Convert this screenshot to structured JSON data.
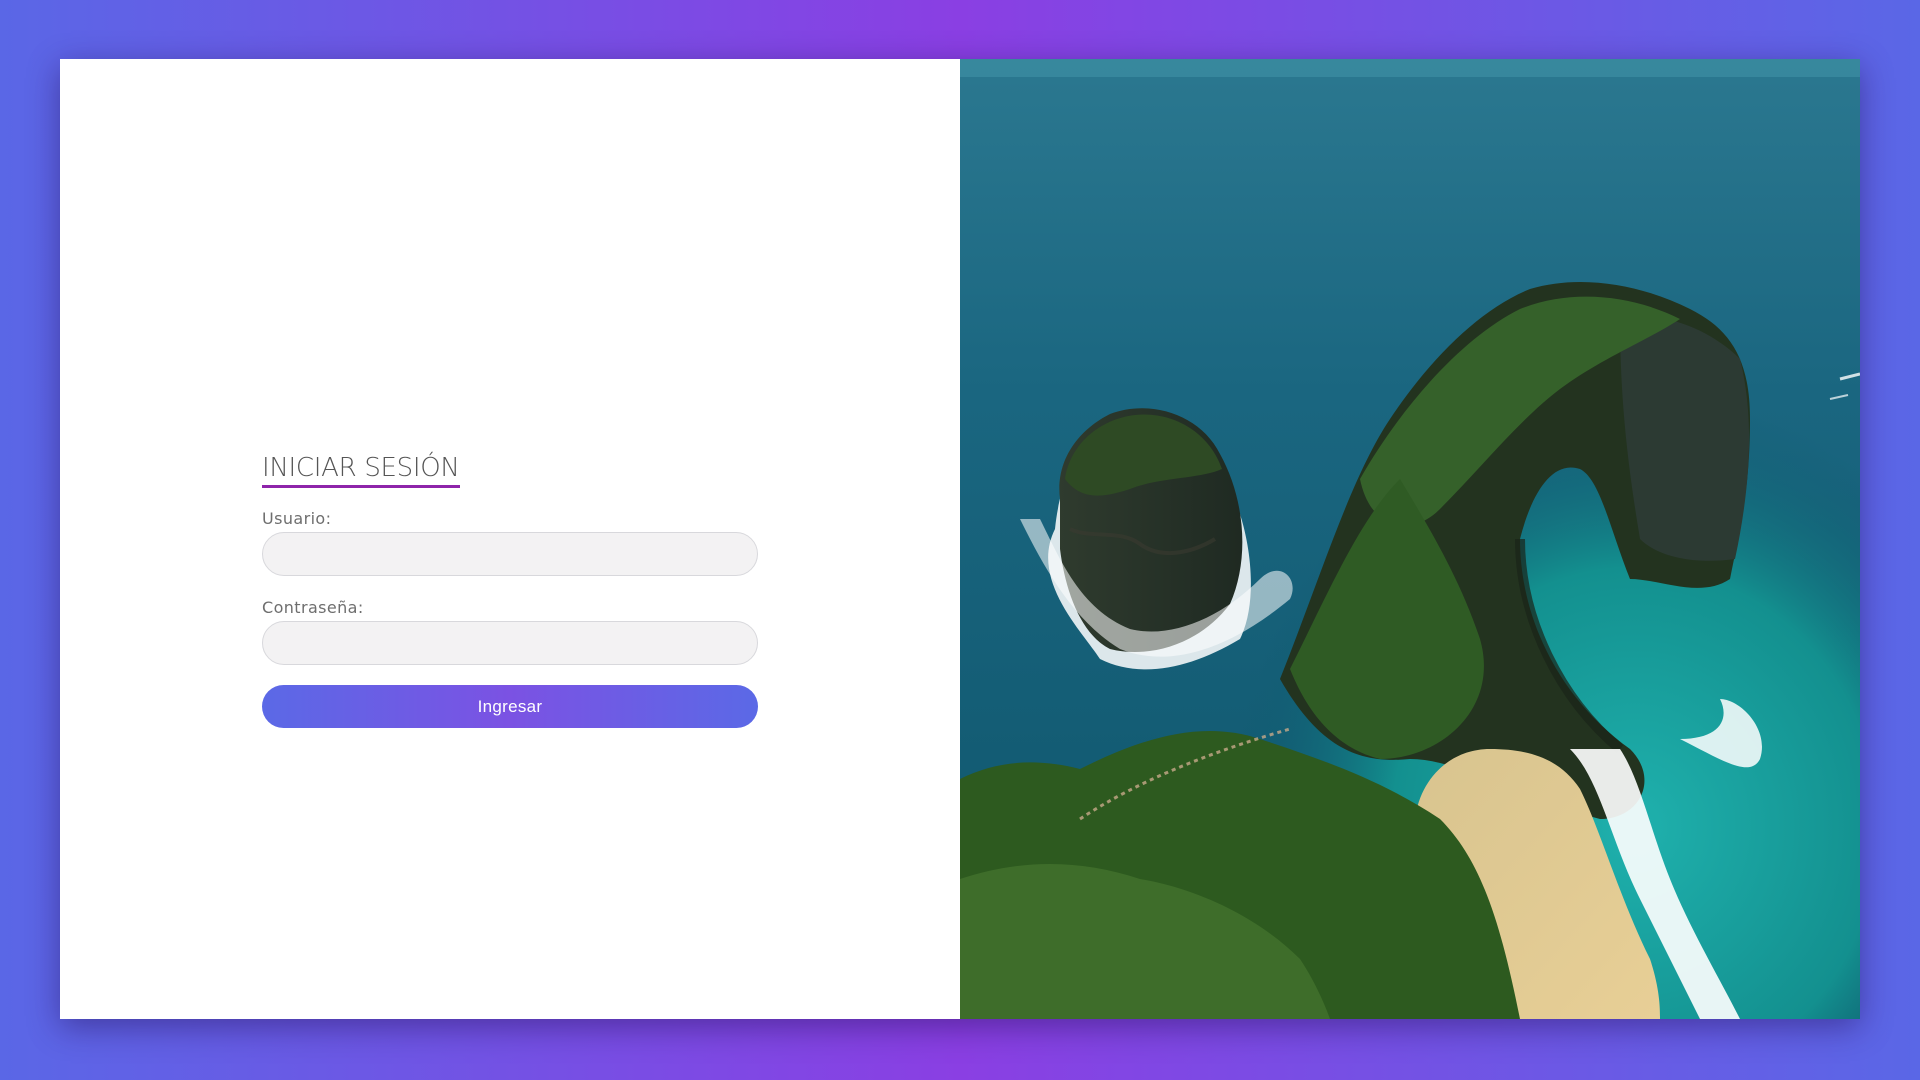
{
  "login": {
    "title": "INICIAR SESIÓN",
    "username_label": "Usuario:",
    "username_value": "",
    "password_label": "Contraseña:",
    "password_value": "",
    "submit_label": "Ingresar"
  },
  "colors": {
    "accent_underline": "#8e24aa",
    "button_gradient_start": "#5b69e6",
    "button_gradient_mid": "#7b52e3",
    "page_gradient_start": "#5a67e6",
    "page_gradient_mid": "#8a3fe3"
  },
  "hero_image": {
    "subject": "aerial-coastal-cliff-photo"
  }
}
